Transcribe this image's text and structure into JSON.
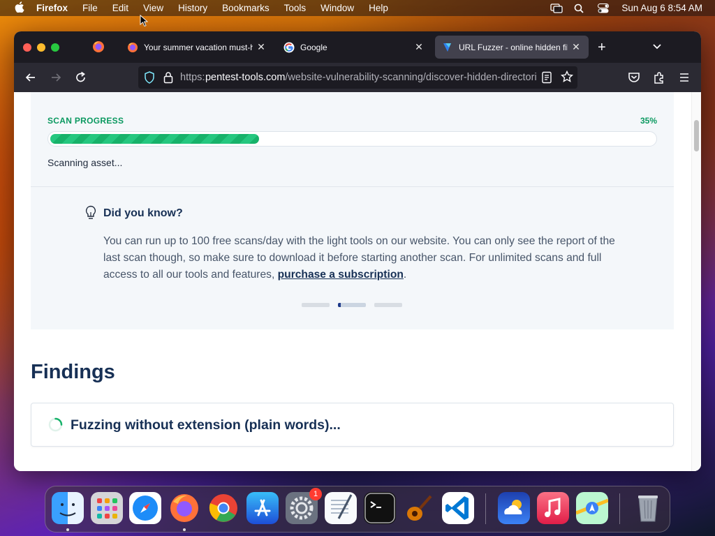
{
  "menubar": {
    "app_name": "Firefox",
    "menus": [
      "File",
      "Edit",
      "View",
      "History",
      "Bookmarks",
      "Tools",
      "Window",
      "Help"
    ],
    "datetime": "Sun Aug 6  8:54 AM"
  },
  "tabs": [
    {
      "title": "Your summer vacation must-hav",
      "favicon": "firefox-icon"
    },
    {
      "title": "Google",
      "favicon": "google-icon"
    },
    {
      "title": "URL Fuzzer - online hidden file & directory finder",
      "favicon": "pentest-tools-icon",
      "active": true
    }
  ],
  "url": {
    "scheme": "https://",
    "host": "pentest-tools.com",
    "path": "/website-vulnerability-scanning/discover-hidden-directories-and-files"
  },
  "scan": {
    "label": "SCAN PROGRESS",
    "percent_text": "35%",
    "progress": 0.35,
    "status": "Scanning asset..."
  },
  "tip": {
    "title": "Did you know?",
    "body_before": "You can run up to 100 free scans/day with the light tools on our website. You can only see the report of the last scan though, so make sure to download it before starting another scan. For unlimited scans and full access to all our tools and features, ",
    "link": "purchase a subscription",
    "body_after": "."
  },
  "findings": {
    "title": "Findings",
    "item": "Fuzzing without extension (plain words)..."
  },
  "dock": {
    "apps": [
      "finder-icon",
      "launchpad-icon",
      "safari-icon",
      "firefox-icon",
      "chrome-icon",
      "app-store-icon",
      "system-settings-icon",
      "textedit-icon",
      "terminal-icon",
      "guitar-icon",
      "vscode-icon",
      "weather-icon",
      "music-icon",
      "maps-icon",
      "trash-icon"
    ],
    "settings_badge": "1"
  }
}
